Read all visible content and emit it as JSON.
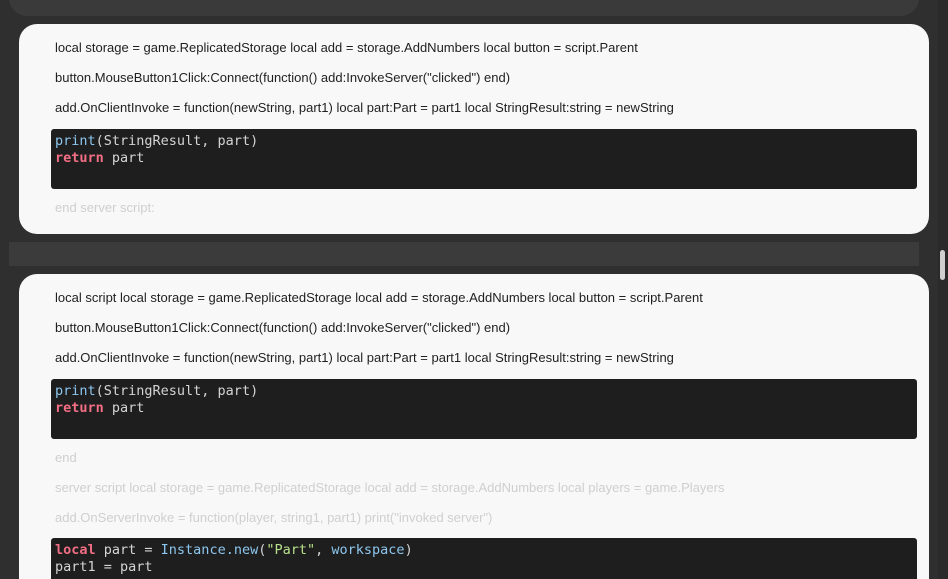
{
  "posts": [
    {
      "lines": [
        "local storage = game.ReplicatedStorage local add = storage.AddNumbers local button = script.Parent",
        "button.MouseButton1Click:Connect(function() add:InvokeServer(\"clicked\") end)",
        "add.OnClientInvoke = function(newString, part1) local part:Part = part1 local StringResult:string = newString"
      ],
      "code": {
        "print_fn": "print",
        "print_args": "(StringResult, part)",
        "return_kw": "return",
        "return_val": " part"
      },
      "after": [
        "end server script:"
      ]
    },
    {
      "lines": [
        "local script local storage = game.ReplicatedStorage local add = storage.AddNumbers local button = script.Parent",
        "button.MouseButton1Click:Connect(function() add:InvokeServer(\"clicked\") end)",
        "add.OnClientInvoke = function(newString, part1) local part:Part = part1 local StringResult:string = newString"
      ],
      "code": {
        "print_fn": "print",
        "print_args": "(StringResult, part)",
        "return_kw": "return",
        "return_val": " part"
      },
      "after": [
        "end",
        "server script local storage = game.ReplicatedStorage local add = storage.AddNumbers local players = game.Players",
        "add.OnServerInvoke = function(player, string1, part1) print(\"invoked server\")"
      ],
      "code2": {
        "local_kw": "local",
        "part_assign": " part = ",
        "instance_new": "Instance.new",
        "open_paren": "(",
        "part_str": "\"Part\"",
        "comma": ", ",
        "workspace": "workspace",
        "close_paren": ")",
        "line2": "part1 = part"
      }
    }
  ]
}
